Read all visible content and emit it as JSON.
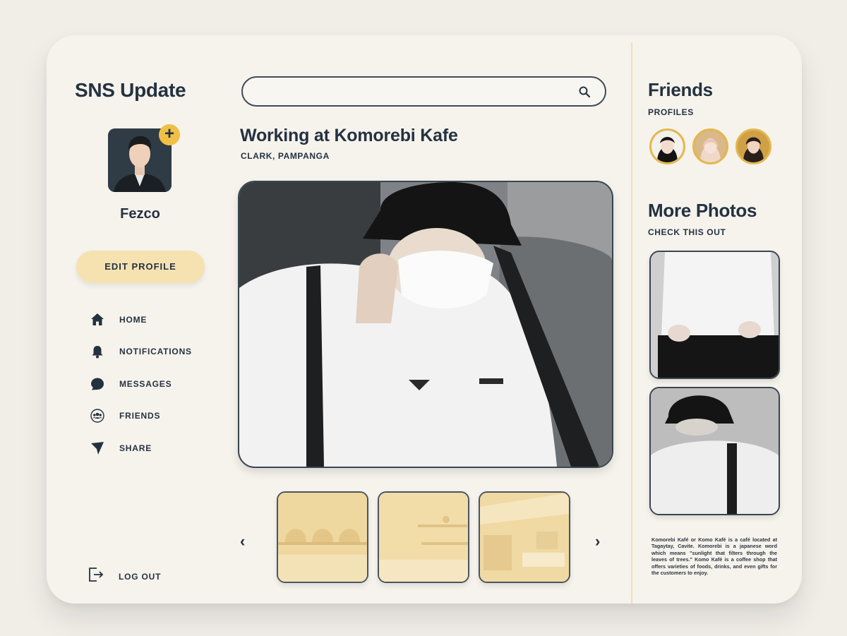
{
  "app": {
    "title": "SNS Update"
  },
  "profile": {
    "name": "Fezco",
    "add_symbol": "+",
    "edit_label": "EDIT PROFILE"
  },
  "nav": [
    {
      "label": "HOME",
      "icon": "home-icon"
    },
    {
      "label": "NOTIFICATIONS",
      "icon": "bell-icon"
    },
    {
      "label": "MESSAGES",
      "icon": "chat-bubble-icon"
    },
    {
      "label": "FRIENDS",
      "icon": "group-icon"
    },
    {
      "label": "SHARE",
      "icon": "send-icon"
    }
  ],
  "logout": {
    "label": "LOG OUT",
    "icon": "logout-icon"
  },
  "search": {
    "value": "",
    "placeholder": ""
  },
  "post": {
    "title": "Working at Komorebi Kafe",
    "location": "CLARK, PAMPANGA",
    "prev_symbol": "‹",
    "next_symbol": "›"
  },
  "sidebar": {
    "friends_title": "Friends",
    "friends_sub": "PROFILES",
    "more_title": "More Photos",
    "more_sub": "CHECK THIS OUT",
    "blurb": "Komorebi Kafé or Komo Kafé is a café located at Tagaytay, Cavite. Komorebi is a japanese word which means \"sunlight that filters through the leaves of trees.\" Komo Kafé is a coffee shop that offers varieties of foods, drinks, and even gifts for the customers to enjoy."
  },
  "colors": {
    "accent": "#f0bf45",
    "button": "#f5e2b0",
    "text": "#243240",
    "card": "#f6f3ed"
  }
}
